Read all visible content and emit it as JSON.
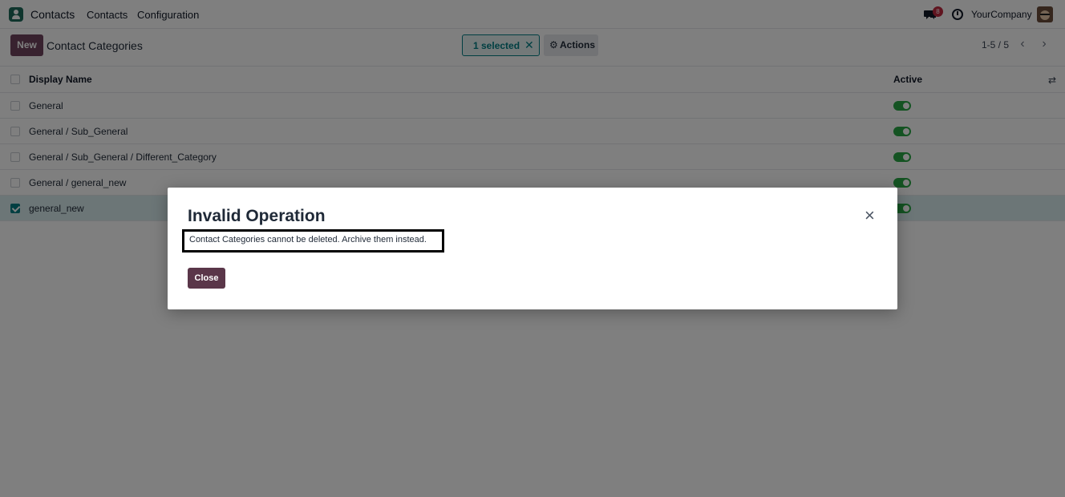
{
  "navbar": {
    "app_name": "Contacts",
    "menu": [
      "Contacts",
      "Configuration"
    ],
    "notification_count": "8",
    "company": "YourCompany"
  },
  "control_panel": {
    "new_label": "New",
    "breadcrumb": "Contact Categories",
    "selected_label": "1 selected",
    "selected_clear": "✕",
    "actions_label": "Actions",
    "pager": "1-5 / 5"
  },
  "list": {
    "columns": {
      "name": "Display Name",
      "active": "Active"
    },
    "rows": [
      {
        "name": "General",
        "active": true,
        "checked": false
      },
      {
        "name": "General / Sub_General",
        "active": true,
        "checked": false
      },
      {
        "name": "General / Sub_General / Different_Category",
        "active": true,
        "checked": false
      },
      {
        "name": "General / general_new",
        "active": true,
        "checked": false
      },
      {
        "name": "general_new",
        "active": true,
        "checked": true
      }
    ]
  },
  "dialog": {
    "title": "Invalid Operation",
    "message": "Contact Categories cannot be deleted. Archive them instead.",
    "close_label": "Close",
    "close_icon": "×"
  },
  "colors": {
    "brand": "#71455e",
    "accent": "#017e84",
    "toggle_on": "#28a745",
    "dialog_button": "#5a3649"
  }
}
